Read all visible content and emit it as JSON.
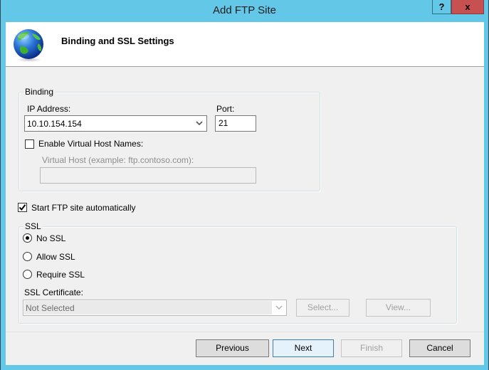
{
  "window": {
    "title": "Add FTP Site",
    "help_label": "?",
    "close_label": "x"
  },
  "header": {
    "title": "Binding and SSL Settings",
    "icon": "globe-icon"
  },
  "binding": {
    "group_label": "Binding",
    "ip_label": "IP Address:",
    "ip_value": "10.10.154.154",
    "port_label": "Port:",
    "port_value": "21",
    "virtual_host_checkbox_label": "Enable Virtual Host Names:",
    "virtual_host_checked": false,
    "virtual_host_label": "Virtual Host (example: ftp.contoso.com):",
    "virtual_host_value": ""
  },
  "start_automatically": {
    "label": "Start FTP site automatically",
    "checked": true
  },
  "ssl": {
    "group_label": "SSL",
    "options": [
      {
        "label": "No SSL",
        "selected": true
      },
      {
        "label": "Allow SSL",
        "selected": false
      },
      {
        "label": "Require SSL",
        "selected": false
      }
    ],
    "certificate_label": "SSL Certificate:",
    "certificate_value": "Not Selected",
    "select_button": "Select...",
    "view_button": "View..."
  },
  "footer": {
    "previous": "Previous",
    "next": "Next",
    "finish": "Finish",
    "cancel": "Cancel"
  },
  "colors": {
    "frame": "#63c8e8",
    "close_button": "#c75050"
  }
}
